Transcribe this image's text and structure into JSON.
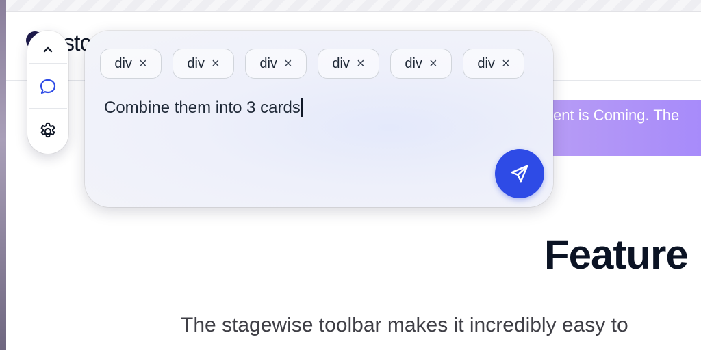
{
  "page": {
    "site_title": "stc",
    "banner_text": "ent is Coming. The",
    "feature_heading": "Feature",
    "subtitle": "The stagewise toolbar makes it incredibly easy to"
  },
  "toolbar": {
    "icons": [
      "chevron-up-icon",
      "chat-bubble-icon",
      "gear-icon"
    ]
  },
  "prompt_panel": {
    "chips": [
      {
        "label": "div",
        "remove": "×"
      },
      {
        "label": "div",
        "remove": "×"
      },
      {
        "label": "div",
        "remove": "×"
      },
      {
        "label": "div",
        "remove": "×"
      },
      {
        "label": "div",
        "remove": "×"
      },
      {
        "label": "div",
        "remove": "×"
      }
    ],
    "input_value": "Combine them into 3 cards",
    "send_icon": "send-icon"
  },
  "colors": {
    "accent": "#2e4be6",
    "banner": "#a78bfa",
    "icon_blue": "#2e4be6"
  }
}
